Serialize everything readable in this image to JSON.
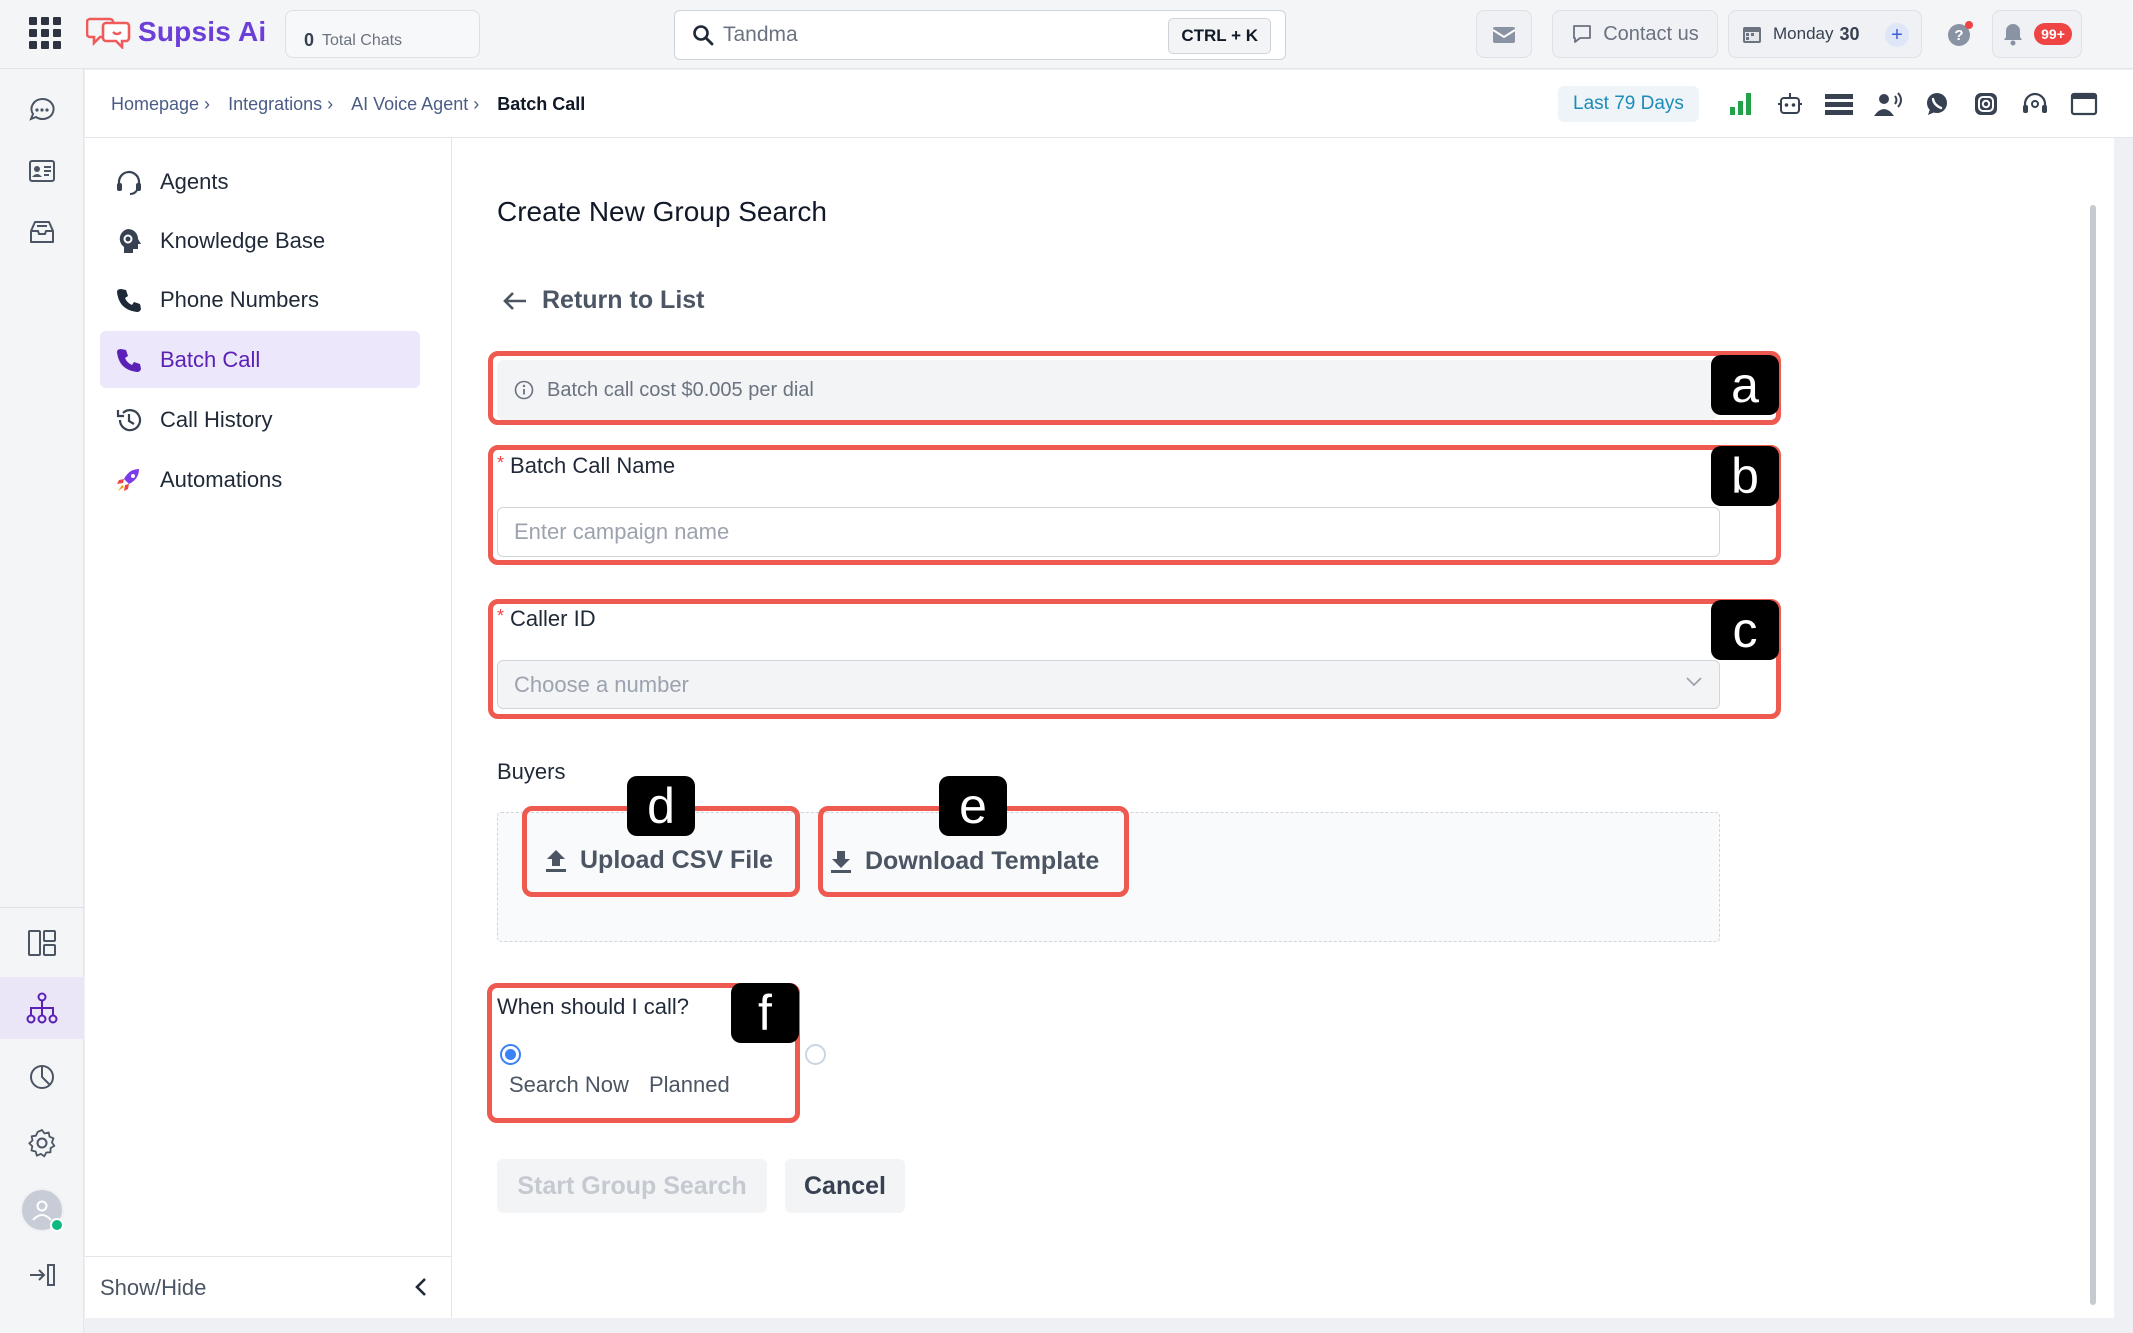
{
  "topbar": {
    "brand": "Supsis Ai",
    "total_chats_count": "0",
    "total_chats_label": "Total Chats",
    "search_value": "Tandma",
    "search_shortcut": "CTRL + K",
    "contact_label": "Contact us",
    "day_label": "Monday",
    "day_number": "30",
    "notifications_badge": "99+"
  },
  "breadcrumb": {
    "items": [
      "Homepage ›",
      "Integrations ›",
      "AI Voice Agent ›"
    ],
    "current": "Batch Call",
    "date_range": "Last 79 Days"
  },
  "sidemenu": {
    "items": [
      {
        "label": "Agents",
        "icon": "headset-icon"
      },
      {
        "label": "Knowledge Base",
        "icon": "brain-icon"
      },
      {
        "label": "Phone Numbers",
        "icon": "phone-icon"
      },
      {
        "label": "Batch Call",
        "icon": "phone-icon",
        "active": true
      },
      {
        "label": "Call History",
        "icon": "history-icon"
      },
      {
        "label": "Automations",
        "icon": "rocket-icon"
      }
    ],
    "show_hide_label": "Show/Hide"
  },
  "form": {
    "title": "Create New Group Search",
    "back_label": "Return to List",
    "info_text": "Batch call cost $0.005 per dial",
    "name_label": "Batch Call Name",
    "name_placeholder": "Enter campaign name",
    "caller_label": "Caller ID",
    "caller_placeholder": "Choose a number",
    "buyers_label": "Buyers",
    "upload_label": "Upload CSV File",
    "download_label": "Download Template",
    "when_label": "When should I call?",
    "option_now": "Search Now",
    "option_planned": "Planned",
    "selected_option": "Search Now",
    "start_label": "Start Group Search",
    "cancel_label": "Cancel"
  },
  "annotations": {
    "a": "a",
    "b": "b",
    "c": "c",
    "d": "d",
    "e": "e",
    "f": "f"
  },
  "colors": {
    "brand": "#6c3fd8",
    "active_menu_bg": "#ece7fb",
    "annotation": "#ee5a4f",
    "link": "#1c8db8"
  }
}
